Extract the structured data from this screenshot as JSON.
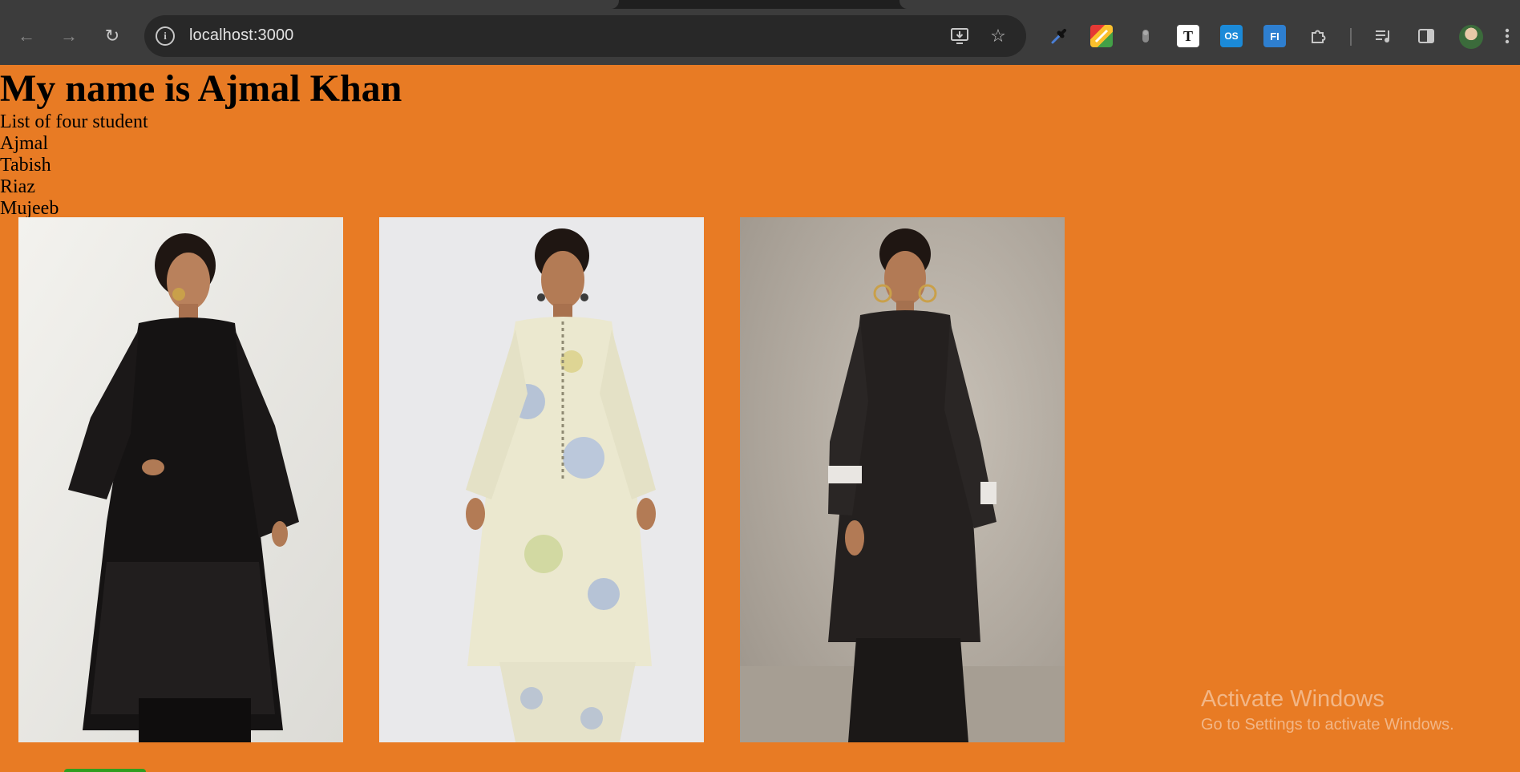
{
  "browser": {
    "url": "localhost:3000",
    "icons": {
      "back": "arrow-left-icon",
      "forward": "arrow-right-icon",
      "reload": "reload-icon",
      "site_info": "info-icon",
      "install": "install-app-icon",
      "bookmark": "star-icon",
      "extensions": [
        "eyedropper-icon",
        "color-palette-icon",
        "ghost-icon",
        "text-T-icon",
        "os-addon-icon",
        "fi-icon",
        "puzzle-extensions-icon"
      ],
      "reading_list": "media-queue-icon",
      "side_panel": "side-panel-icon",
      "profile": "avatar",
      "menu": "kebab-menu-icon"
    },
    "ext_labels": {
      "text_t": "T",
      "os": "OS",
      "fi": "FI"
    }
  },
  "page": {
    "title": "My name is Ajmal Khan",
    "list_heading": "List of four student",
    "students": [
      "Ajmal",
      "Tabish",
      "Riaz",
      "Mujeeb"
    ],
    "background_color": "#e87b24",
    "photos": [
      {
        "name": "model-black-lace-kurta"
      },
      {
        "name": "model-floral-cream-kurta"
      },
      {
        "name": "model-black-kurta-white-cuffs"
      }
    ]
  },
  "watermark": {
    "line1": "Activate Windows",
    "line2": "Go to Settings to activate Windows."
  }
}
